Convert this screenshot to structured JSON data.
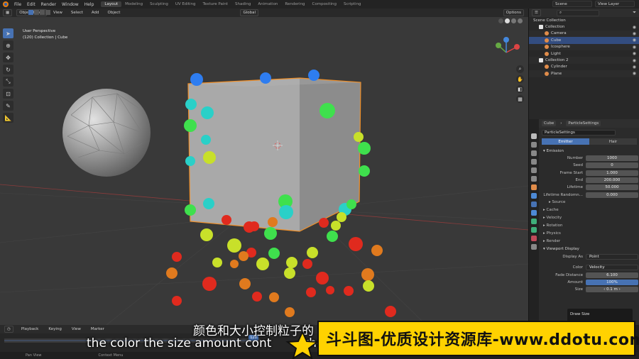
{
  "menu": [
    "File",
    "Edit",
    "Render",
    "Window",
    "Help"
  ],
  "workspaces": [
    {
      "label": "Layout",
      "active": true
    },
    {
      "label": "Modeling",
      "active": false
    },
    {
      "label": "Sculpting",
      "active": false
    },
    {
      "label": "UV Editing",
      "active": false
    },
    {
      "label": "Texture Paint",
      "active": false
    },
    {
      "label": "Shading",
      "active": false
    },
    {
      "label": "Animation",
      "active": false
    },
    {
      "label": "Rendering",
      "active": false
    },
    {
      "label": "Compositing",
      "active": false
    },
    {
      "label": "Scripting",
      "active": false
    }
  ],
  "scene_name": "Scene",
  "view_layer": "View Layer",
  "viewport": {
    "mode": "Object Mode",
    "menus": [
      "View",
      "Select",
      "Add",
      "Object"
    ],
    "orientation": "Global",
    "options_label": "Options",
    "info_line1": "User Perspective",
    "info_line2": "(120) Collection | Cube"
  },
  "outliner": {
    "title": "Scene Collection",
    "rows": [
      {
        "label": "Collection",
        "indent": 1,
        "icon_color": "#e6e6e6",
        "selected": false
      },
      {
        "label": "Camera",
        "indent": 2,
        "icon_color": "#e08c4a",
        "selected": false
      },
      {
        "label": "Cube",
        "indent": 2,
        "icon_color": "#e08c4a",
        "selected": true
      },
      {
        "label": "Icosphere",
        "indent": 2,
        "icon_color": "#e08c4a",
        "selected": false
      },
      {
        "label": "Light",
        "indent": 2,
        "icon_color": "#e08c4a",
        "selected": false
      },
      {
        "label": "Collection 2",
        "indent": 1,
        "icon_color": "#e6e6e6",
        "selected": false
      },
      {
        "label": "Cylinder",
        "indent": 2,
        "icon_color": "#e08c4a",
        "selected": false
      },
      {
        "label": "Plane",
        "indent": 2,
        "icon_color": "#e08c4a",
        "selected": false
      }
    ]
  },
  "properties": {
    "crumb_object": "Cube",
    "crumb_settings": "ParticleSettings",
    "particle_system": "ParticleSettings",
    "tabs": [
      "Emitter",
      "Hair"
    ],
    "emission_title": "Emission",
    "emission": [
      {
        "label": "Number",
        "value": "1000"
      },
      {
        "label": "Seed",
        "value": "0"
      },
      {
        "label": "Frame Start",
        "value": "1.000"
      },
      {
        "label": "End",
        "value": "200.000"
      },
      {
        "label": "Lifetime",
        "value": "50.000"
      },
      {
        "label": "Lifetime Randomn...",
        "value": "0.000"
      }
    ],
    "source": "Source",
    "panels": [
      "Cache",
      "Velocity",
      "Rotation",
      "Physics",
      "Render"
    ],
    "viewport_display_title": "Viewport Display",
    "display_as_label": "Display As",
    "display_as_value": "Point",
    "color_label": "Color",
    "color_value": "Velocity",
    "fade_label": "Fade Distance",
    "fade_value": "6.100",
    "amount_label": "Amount",
    "amount_value": "100%",
    "size_label": "Size",
    "size_value": "0.1 m",
    "tooltip": "Draw Size"
  },
  "timeline": {
    "menus": [
      "Playback",
      "Keying",
      "View",
      "Marker"
    ],
    "current_frame": "120"
  },
  "statusbar": [
    "Pan View",
    "Context Menu"
  ],
  "subtitle_cn": "颜色和大小控制粒子的",
  "subtitle_en": "the color the size amount cont",
  "subtitle_en_tail": "the",
  "watermark": "斗斗图-优质设计资源库-www.ddotu.com",
  "particle_colors": [
    "#2e7df0",
    "#2ad0c8",
    "#3fe04d",
    "#c8e02a",
    "#e07a1e",
    "#e02a1e"
  ]
}
